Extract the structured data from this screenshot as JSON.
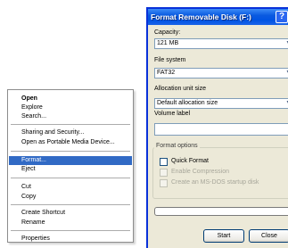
{
  "context_menu": {
    "items": [
      {
        "label": "Open",
        "bold": true
      },
      {
        "label": "Explore"
      },
      {
        "label": "Search..."
      },
      {
        "label": "Sharing and Security..."
      },
      {
        "label": "Open as Portable Media Device..."
      },
      {
        "label": "Format...",
        "highlighted": true
      },
      {
        "label": "Eject"
      },
      {
        "label": "Cut"
      },
      {
        "label": "Copy"
      },
      {
        "label": "Create Shortcut"
      },
      {
        "label": "Rename"
      },
      {
        "label": "Properties"
      }
    ]
  },
  "dialog": {
    "title": "Format Removable Disk (F:)",
    "help_glyph": "?",
    "close_glyph": "×",
    "capacity": {
      "label": "Capacity:",
      "value": "121 MB"
    },
    "file_system": {
      "label": "File system",
      "value": "FAT32"
    },
    "allocation": {
      "label": "Allocation unit size",
      "value": "Default allocation size"
    },
    "volume_label": {
      "label": "Volume label",
      "value": ""
    },
    "format_options": {
      "legend": "Format options",
      "quick_format": "Quick Format",
      "enable_compression": "Enable Compression",
      "msdos_startup": "Create an MS-DOS startup disk"
    },
    "progress": 0,
    "start_button": "Start",
    "close_button": "Close"
  },
  "icons": {
    "dropdown": "dropdown-arrow-icon"
  },
  "colors": {
    "menu_highlight": "#316ac5",
    "title_bar": "#0054e3",
    "dialog_bg": "#ece9d8"
  }
}
